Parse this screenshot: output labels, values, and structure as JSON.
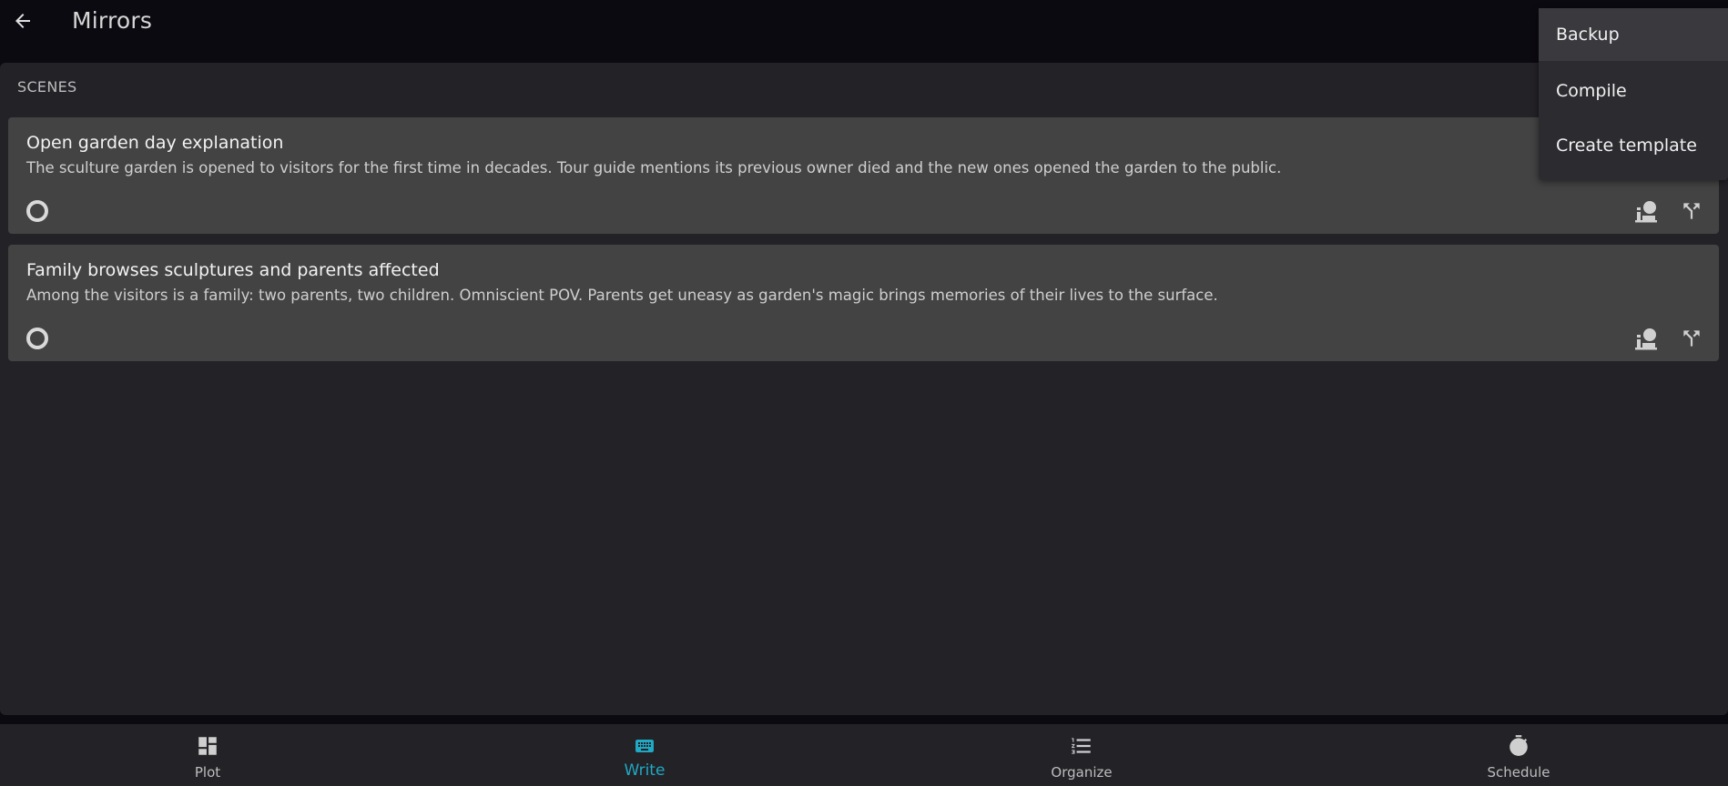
{
  "header": {
    "title": "Mirrors",
    "back_icon": "arrow-left-icon"
  },
  "scenes": {
    "section_label": "SCENES",
    "items": [
      {
        "title": "Open garden day explanation",
        "description": "The sculture garden is opened to visitors for the first time in decades. Tour guide mentions its previous owner died and the new ones opened the garden to the public."
      },
      {
        "title": "Family browses sculptures and parents affected",
        "description": "Among the visitors is a family: two parents, two children. Omniscient POV. Parents get uneasy as garden's magic brings memories of their lives to the surface."
      }
    ]
  },
  "menu": {
    "items": [
      {
        "label": "Backup"
      },
      {
        "label": "Compile"
      },
      {
        "label": "Create template"
      }
    ]
  },
  "bottom_nav": {
    "items": [
      {
        "label": "Plot",
        "icon": "dashboard-icon"
      },
      {
        "label": "Write",
        "icon": "keyboard-icon"
      },
      {
        "label": "Organize",
        "icon": "list-numbered-icon"
      },
      {
        "label": "Schedule",
        "icon": "timer-icon"
      }
    ],
    "active": "Write"
  },
  "colors": {
    "background": "#0b0a10",
    "panel": "#232227",
    "card": "#434343",
    "menu": "#2c2b30",
    "accent": "#1fa9c4"
  }
}
